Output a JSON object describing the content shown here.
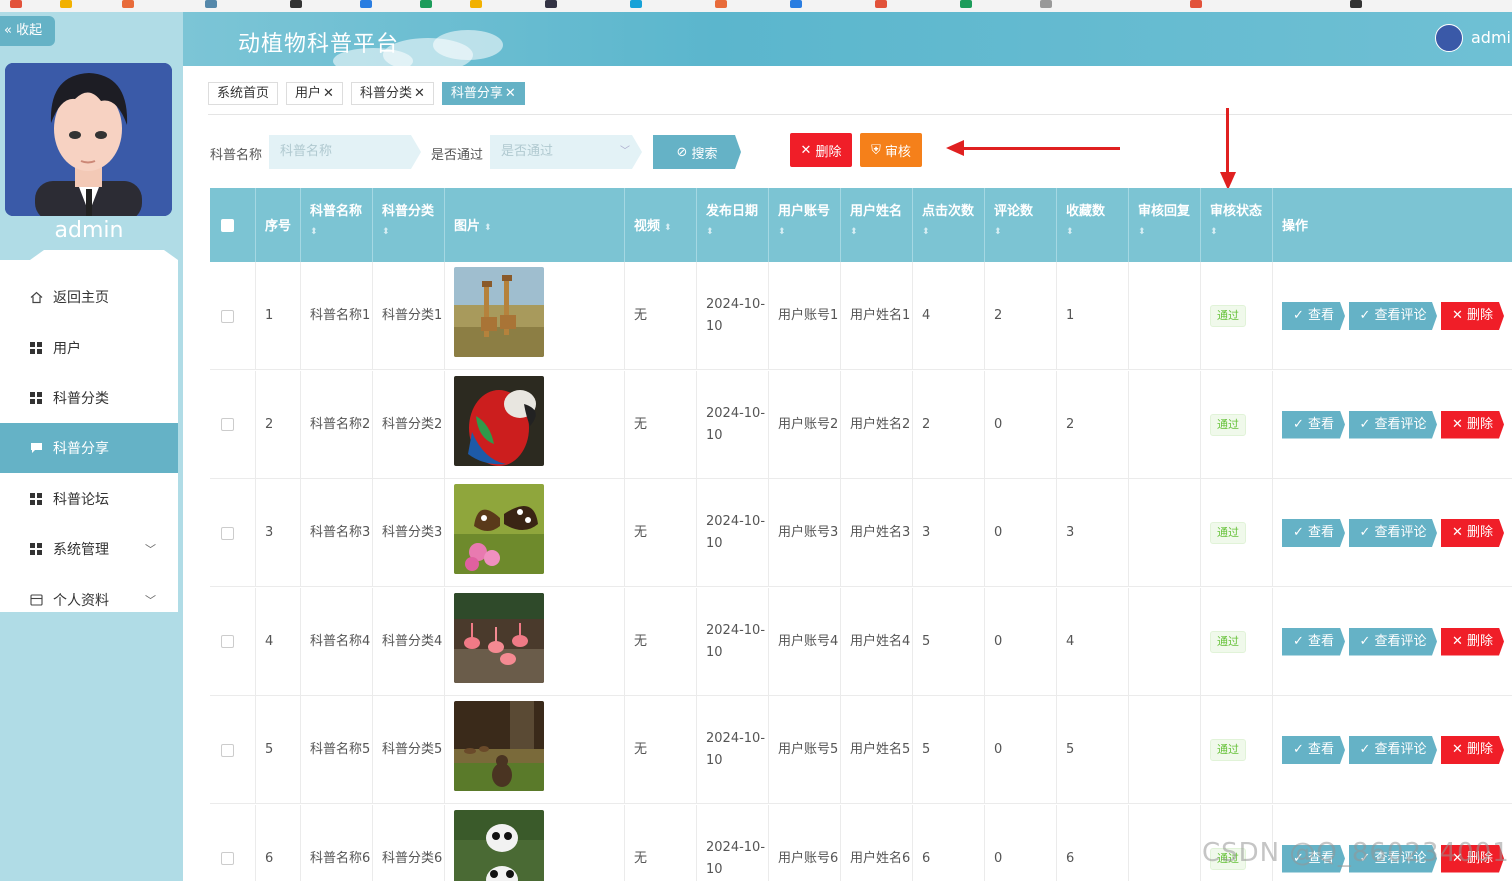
{
  "sidebar": {
    "collapse_label": "收起",
    "admin_name": "admin",
    "items": [
      {
        "label": "返回主页",
        "icon": "home-icon"
      },
      {
        "label": "用户",
        "icon": "grid-icon"
      },
      {
        "label": "科普分类",
        "icon": "grid-icon"
      },
      {
        "label": "科普分享",
        "icon": "chat-icon",
        "active": true
      },
      {
        "label": "科普论坛",
        "icon": "grid-icon"
      },
      {
        "label": "系统管理",
        "icon": "grid-icon",
        "expandable": true
      },
      {
        "label": "个人资料",
        "icon": "card-icon",
        "expandable": true
      }
    ]
  },
  "header": {
    "title": "动植物科普平台",
    "user": "admin"
  },
  "tabs": [
    {
      "label": "系统首页",
      "closable": false
    },
    {
      "label": "用户",
      "closable": true
    },
    {
      "label": "科普分类",
      "closable": true
    },
    {
      "label": "科普分享",
      "closable": true,
      "active": true
    }
  ],
  "search": {
    "name_label": "科普名称",
    "name_placeholder": "科普名称",
    "pass_label": "是否通过",
    "pass_placeholder": "是否通过",
    "search_button": "搜索",
    "delete_button": "删除",
    "audit_button": "审核"
  },
  "table": {
    "headers": [
      "序号",
      "科普名称",
      "科普分类",
      "图片",
      "视频",
      "发布日期",
      "用户账号",
      "用户姓名",
      "点击次数",
      "评论数",
      "收藏数",
      "审核回复",
      "审核状态",
      "操作"
    ],
    "rows": [
      {
        "no": "1",
        "name": "科普名称1",
        "category": "科普分类1",
        "video": "无",
        "date": "2024-10-10",
        "account": "用户账号1",
        "username": "用户姓名1",
        "clicks": "4",
        "comments": "2",
        "favorites": "1",
        "reply": "",
        "status": "通过",
        "img": "giraffe"
      },
      {
        "no": "2",
        "name": "科普名称2",
        "category": "科普分类2",
        "video": "无",
        "date": "2024-10-10",
        "account": "用户账号2",
        "username": "用户姓名2",
        "clicks": "2",
        "comments": "0",
        "favorites": "2",
        "reply": "",
        "status": "通过",
        "img": "parrot"
      },
      {
        "no": "3",
        "name": "科普名称3",
        "category": "科普分类3",
        "video": "无",
        "date": "2024-10-10",
        "account": "用户账号3",
        "username": "用户姓名3",
        "clicks": "3",
        "comments": "0",
        "favorites": "3",
        "reply": "",
        "status": "通过",
        "img": "butterfly"
      },
      {
        "no": "4",
        "name": "科普名称4",
        "category": "科普分类4",
        "video": "无",
        "date": "2024-10-10",
        "account": "用户账号4",
        "username": "用户姓名4",
        "clicks": "5",
        "comments": "0",
        "favorites": "4",
        "reply": "",
        "status": "通过",
        "img": "flamingo"
      },
      {
        "no": "5",
        "name": "科普名称5",
        "category": "科普分类5",
        "video": "无",
        "date": "2024-10-10",
        "account": "用户账号5",
        "username": "用户姓名5",
        "clicks": "5",
        "comments": "0",
        "favorites": "5",
        "reply": "",
        "status": "通过",
        "img": "bear"
      },
      {
        "no": "6",
        "name": "科普名称6",
        "category": "科普分类6",
        "video": "无",
        "date": "2024-10-10",
        "account": "用户账号6",
        "username": "用户姓名6",
        "clicks": "6",
        "comments": "0",
        "favorites": "6",
        "reply": "",
        "status": "通过",
        "img": "panda"
      }
    ],
    "actions": {
      "view": "查看",
      "comments": "查看评论",
      "delete": "删除"
    }
  },
  "watermark": "CSDN @Q_860234001",
  "colors": {
    "accent": "#65b2c6",
    "danger": "#f01e28",
    "warning": "#f5801a"
  }
}
